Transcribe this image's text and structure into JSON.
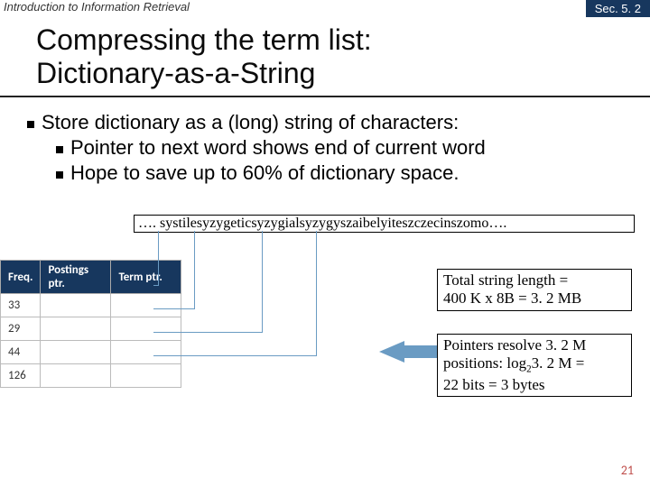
{
  "header": {
    "course": "Introduction to Information Retrieval",
    "section": "Sec. 5. 2"
  },
  "title_line1": "Compressing the term list:",
  "title_line2": "Dictionary-as-a-String",
  "bullets": {
    "b1": "Store dictionary as a (long) string of characters:",
    "b2a": "Pointer to next word shows end of current word",
    "b2b": "Hope to save up to 60% of dictionary space."
  },
  "longstring": "…. systilesyzygeticsyzygialsyzygyszaibelyiteszczecinszomo….",
  "table": {
    "headers": [
      "Freq.",
      "Postings ptr.",
      "Term ptr."
    ],
    "rows": [
      "33",
      "29",
      "44",
      "126"
    ]
  },
  "box1_l1": "Total string length =",
  "box1_l2": "400 K x 8B = 3. 2 MB",
  "box2_l1": "Pointers resolve 3. 2 M",
  "box2_l2_a": "positions: log",
  "box2_l2_sub": "2",
  "box2_l2_b": "3. 2 M =",
  "box2_l3": "22 bits = 3 bytes",
  "slidenum": "21"
}
